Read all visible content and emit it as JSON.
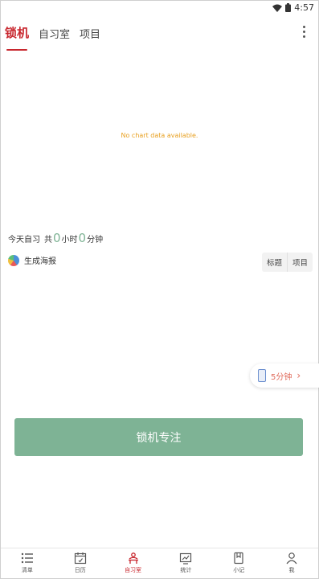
{
  "status_bar": {
    "time": "4:57"
  },
  "tabs": [
    {
      "label": "锁机",
      "active": true
    },
    {
      "label": "自习室",
      "active": false
    },
    {
      "label": "项目",
      "active": false
    }
  ],
  "chart": {
    "empty_message": "No chart data available."
  },
  "summary": {
    "prefix": "今天自习",
    "gong": "共",
    "hours": "0",
    "hours_unit": "小时",
    "minutes": "0",
    "minutes_unit": "分钟"
  },
  "poster": {
    "label": "生成海报"
  },
  "segment": {
    "title_label": "标题",
    "project_label": "项目"
  },
  "timer": {
    "label": "5分钟"
  },
  "lock_button": {
    "label": "锁机专注"
  },
  "bottom_nav": [
    {
      "label": "清单",
      "icon": "list-icon"
    },
    {
      "label": "日历",
      "icon": "calendar-icon"
    },
    {
      "label": "自习室",
      "icon": "study-room-icon",
      "active": true
    },
    {
      "label": "统计",
      "icon": "stats-icon"
    },
    {
      "label": "小记",
      "icon": "note-icon"
    },
    {
      "label": "我",
      "icon": "person-icon"
    }
  ],
  "colors": {
    "accent_red": "#c8272e",
    "green": "#7eb395",
    "no_data_orange": "#e8a020",
    "timer_red": "#e06a5a"
  }
}
